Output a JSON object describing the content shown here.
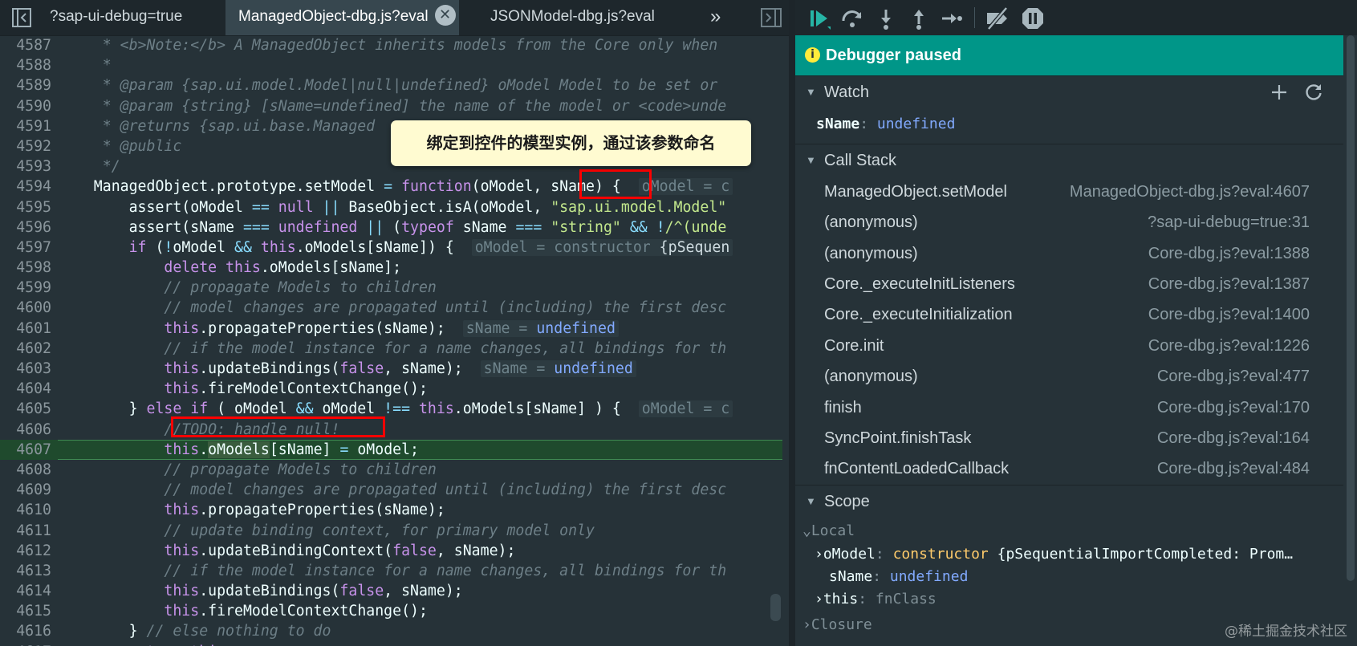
{
  "editor": {
    "tabs": [
      {
        "label": "?sap-ui-debug=true",
        "active": false
      },
      {
        "label": "ManagedObject-dbg.js?eval",
        "active": true
      },
      {
        "label": "JSONModel-dbg.js?eval",
        "active": false
      }
    ],
    "tab_close_glyph": "✕",
    "tab_overflow_glyph": "»",
    "current_line": 4607
  },
  "callout": {
    "text": "绑定到控件的模型实例，通过该参数命名"
  },
  "debugger": {
    "status": "Debugger paused",
    "watch": {
      "title": "Watch",
      "expressions": [
        {
          "name": "sName",
          "value": "undefined"
        }
      ]
    },
    "call_stack": {
      "title": "Call Stack",
      "frames": [
        {
          "fn": "ManagedObject.setModel",
          "loc": "ManagedObject-dbg.js?eval:4607"
        },
        {
          "fn": "(anonymous)",
          "loc": "?sap-ui-debug=true:31"
        },
        {
          "fn": "(anonymous)",
          "loc": "Core-dbg.js?eval:1388"
        },
        {
          "fn": "Core._executeInitListeners",
          "loc": "Core-dbg.js?eval:1387"
        },
        {
          "fn": "Core._executeInitialization",
          "loc": "Core-dbg.js?eval:1400"
        },
        {
          "fn": "Core.init",
          "loc": "Core-dbg.js?eval:1226"
        },
        {
          "fn": "(anonymous)",
          "loc": "Core-dbg.js?eval:477"
        },
        {
          "fn": "finish",
          "loc": "Core-dbg.js?eval:170"
        },
        {
          "fn": "SyncPoint.finishTask",
          "loc": "Core-dbg.js?eval:164"
        },
        {
          "fn": "fnContentLoadedCallback",
          "loc": "Core-dbg.js?eval:484"
        }
      ]
    },
    "scope": {
      "title": "Scope",
      "local_title": "Local",
      "vars": {
        "oModel": {
          "name": "oModel",
          "sep": ":",
          "value": "constructor",
          "detail": "{pSequentialImportCompleted: Prom…"
        },
        "sName": {
          "name": "sName",
          "sep": ":",
          "value": "undefined"
        },
        "this": {
          "name": "this",
          "sep": ":",
          "value": "fnClass"
        }
      },
      "closure_title": "Closure"
    }
  },
  "watermark": "@稀土掘金技术社区",
  "colors": {
    "paused_banner": "#009688",
    "current_line": "#1f4a2d",
    "callout_bg": "#fffbd1",
    "annotation_red": "#ff0000"
  }
}
